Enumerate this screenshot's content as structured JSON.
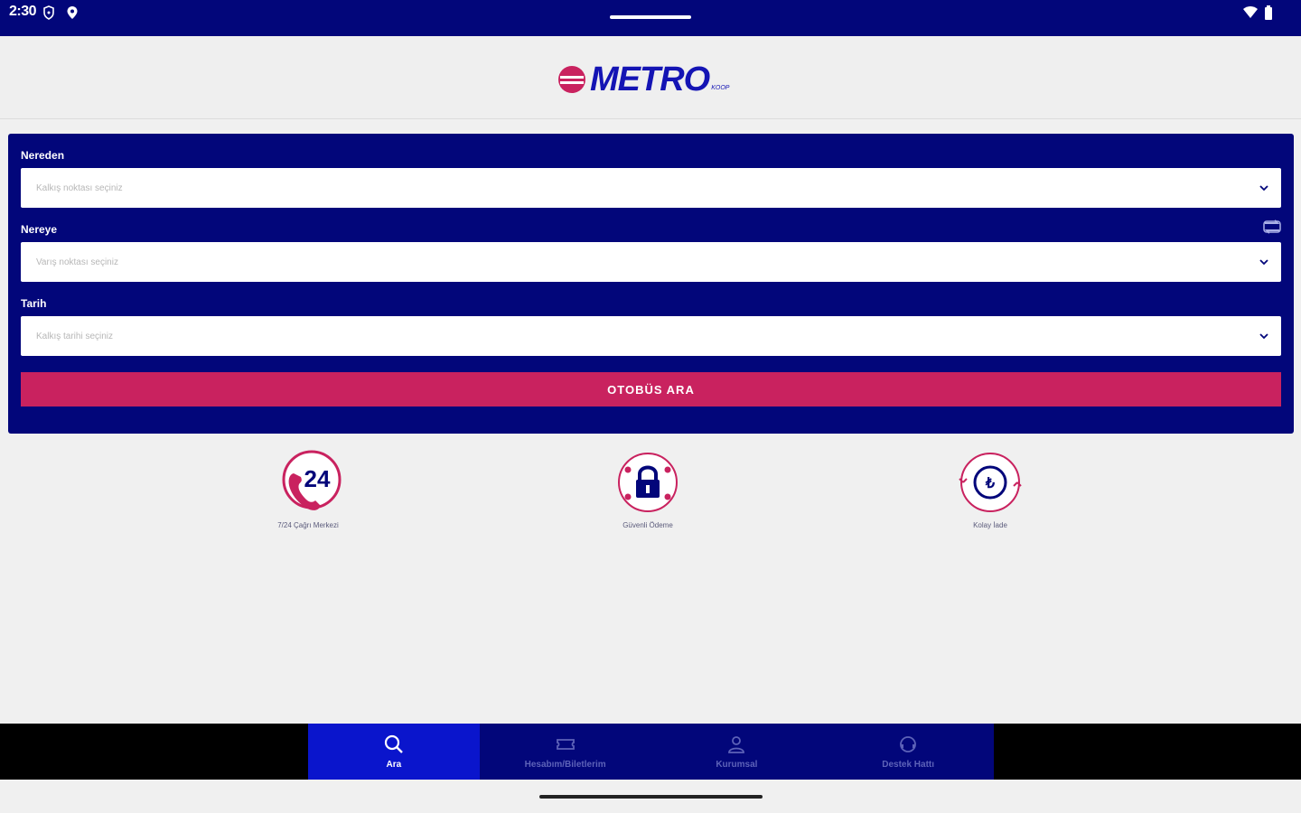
{
  "status_bar": {
    "time": "2:30"
  },
  "header": {
    "logo_text": "METRO",
    "logo_suffix": "KOOP"
  },
  "search": {
    "from_label": "Nereden",
    "from_placeholder": "Kalkış noktası seçiniz",
    "to_label": "Nereye",
    "to_placeholder": "Varış noktası seçiniz",
    "date_label": "Tarih",
    "date_placeholder": "Kalkış tarihi seçiniz",
    "button_label": "OTOBÜS ARA"
  },
  "features": [
    {
      "icon": "24-hour-phone-icon",
      "badge": "24",
      "caption": "7/24 Çağrı Merkezi"
    },
    {
      "icon": "secure-lock-icon",
      "caption": "Güvenli Ödeme"
    },
    {
      "icon": "refund-icon",
      "caption": "Kolay İade"
    }
  ],
  "bottom_nav": [
    {
      "icon": "search-icon",
      "label": "Ara"
    },
    {
      "icon": "ticket-icon",
      "label": "Hesabım/Biletlerim"
    },
    {
      "icon": "user-icon",
      "label": "Kurumsal"
    },
    {
      "icon": "support-icon",
      "label": "Destek Hattı"
    }
  ],
  "colors": {
    "primary": "#02067a",
    "accent": "#c9225f",
    "nav_active": "#0a15cc",
    "background": "#f0f0f0"
  }
}
